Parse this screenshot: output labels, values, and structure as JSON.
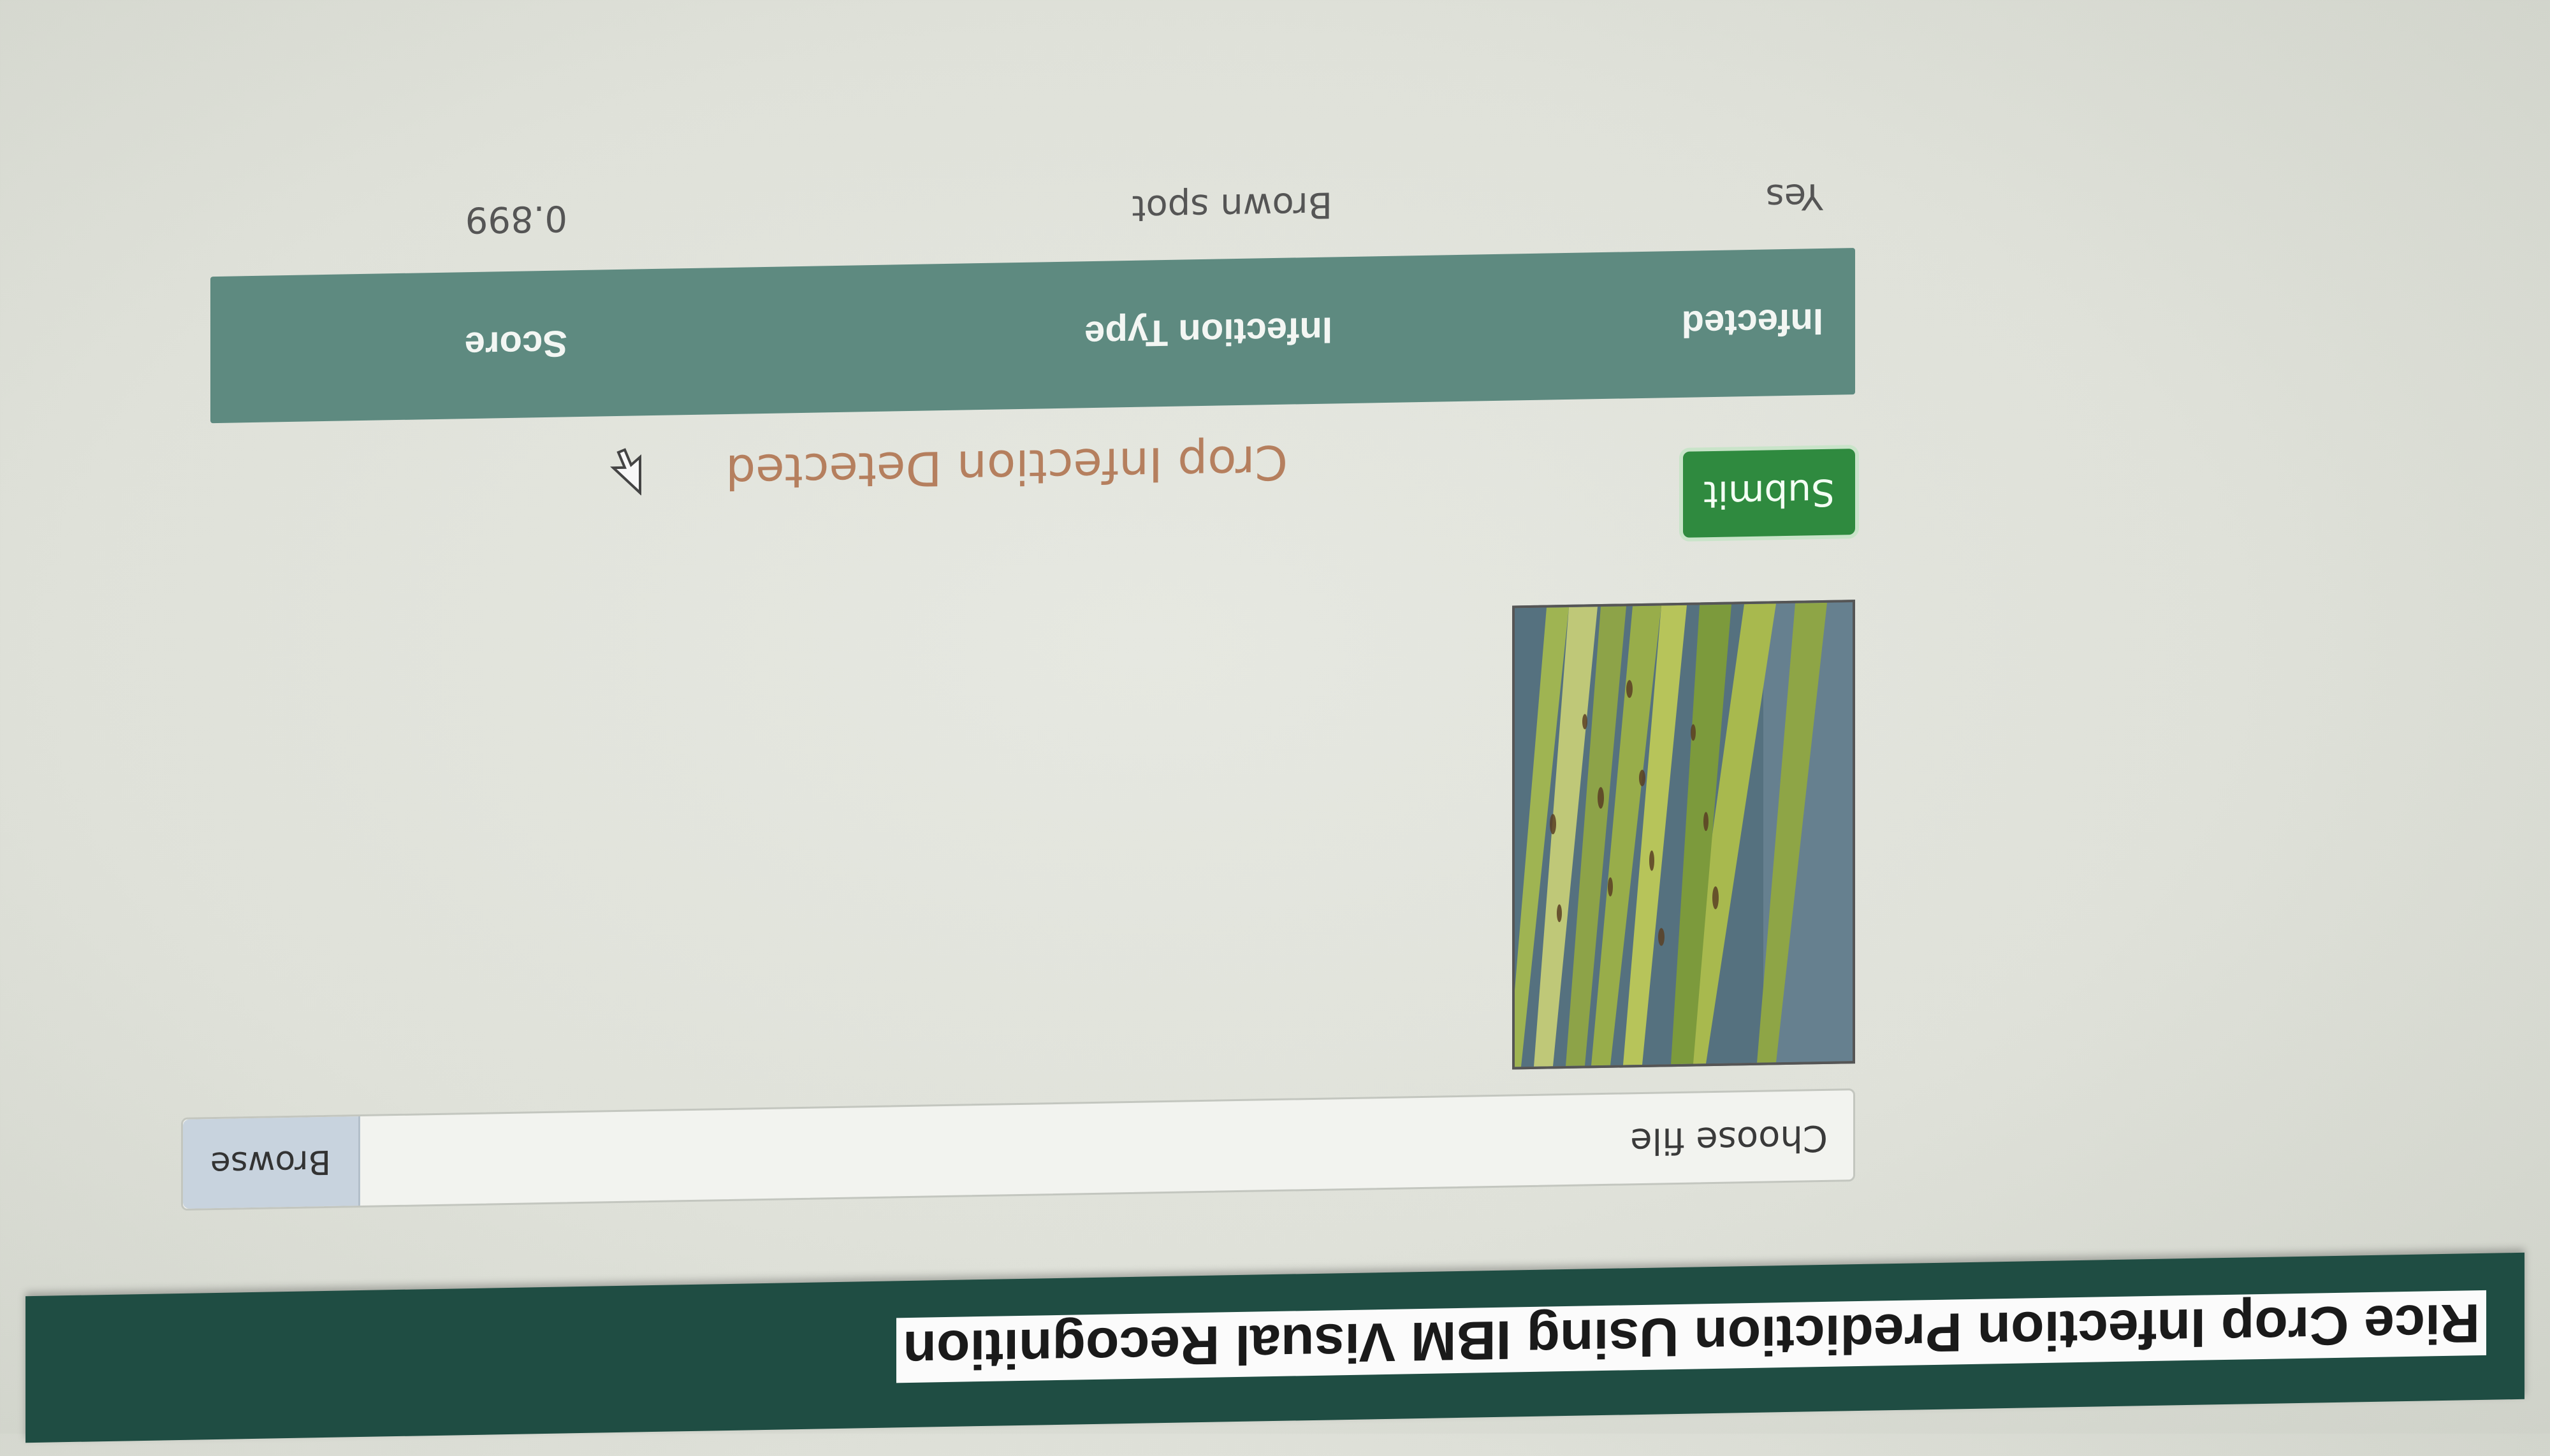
{
  "header": {
    "title": "Rice Crop Infection Prediction Using IBM Visual Recognition"
  },
  "file_input": {
    "label": "Choose file",
    "browse_label": "Browse"
  },
  "submit": {
    "label": "Submit"
  },
  "result": {
    "title": "Crop Infection Detected",
    "columns": [
      "Infected",
      "Infection Type",
      "Score"
    ],
    "rows": [
      [
        "Yes",
        "Brown spot",
        "0.899"
      ]
    ]
  },
  "colors": {
    "header_bg": "#1f4d43",
    "submit_bg": "#2f8a3f",
    "table_header_bg": "#5e8a80",
    "result_title": "#b57f5e"
  }
}
